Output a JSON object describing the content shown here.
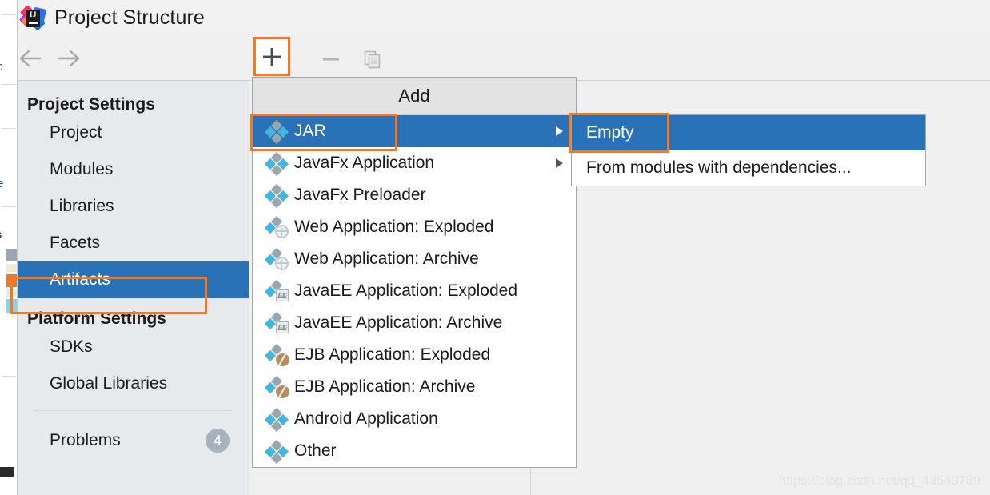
{
  "window": {
    "title": "Project Structure",
    "logo_icon": "intellij-idea-logo"
  },
  "toolbar": {
    "back_icon": "arrow-left-icon",
    "forward_icon": "arrow-right-icon",
    "add_icon": "plus-icon",
    "remove_icon": "minus-icon",
    "copy_icon": "copy-icon"
  },
  "sidebar": {
    "project_settings_label": "Project Settings",
    "project_items": [
      {
        "label": "Project"
      },
      {
        "label": "Modules"
      },
      {
        "label": "Libraries"
      },
      {
        "label": "Facets"
      },
      {
        "label": "Artifacts",
        "selected": true
      }
    ],
    "platform_settings_label": "Platform Settings",
    "platform_items": [
      {
        "label": "SDKs"
      },
      {
        "label": "Global Libraries"
      }
    ],
    "problems_label": "Problems",
    "problems_count": "4"
  },
  "add_menu": {
    "header": "Add",
    "items": [
      {
        "label": "JAR",
        "icon": "artifact-jar-icon",
        "has_submenu": true,
        "highlighted": true
      },
      {
        "label": "JavaFx Application",
        "icon": "artifact-javafx-icon",
        "has_submenu": true,
        "highlighted": false
      },
      {
        "label": "JavaFx Preloader",
        "icon": "artifact-javafx-icon",
        "has_submenu": false,
        "highlighted": false
      },
      {
        "label": "Web Application: Exploded",
        "icon": "artifact-web-icon",
        "has_submenu": false,
        "highlighted": false
      },
      {
        "label": "Web Application: Archive",
        "icon": "artifact-web-icon",
        "has_submenu": false,
        "highlighted": false
      },
      {
        "label": "JavaEE Application: Exploded",
        "icon": "artifact-javaee-icon",
        "has_submenu": false,
        "highlighted": false
      },
      {
        "label": "JavaEE Application: Archive",
        "icon": "artifact-javaee-icon",
        "has_submenu": false,
        "highlighted": false
      },
      {
        "label": "EJB Application: Exploded",
        "icon": "artifact-ejb-icon",
        "has_submenu": false,
        "highlighted": false
      },
      {
        "label": "EJB Application: Archive",
        "icon": "artifact-ejb-icon",
        "has_submenu": false,
        "highlighted": false
      },
      {
        "label": "Android Application",
        "icon": "artifact-android-icon",
        "has_submenu": false,
        "highlighted": false
      },
      {
        "label": "Other",
        "icon": "artifact-other-icon",
        "has_submenu": false,
        "highlighted": false
      }
    ]
  },
  "jar_submenu": {
    "items": [
      {
        "label": "Empty",
        "highlighted": true
      },
      {
        "label": "From modules with dependencies...",
        "highlighted": false
      }
    ]
  },
  "annotations": {
    "highlight_color": "#f47920",
    "boxes": [
      "plus-toolbar-button",
      "artifacts-sidebar-item",
      "jar-menu-item",
      "empty-submenu-item"
    ]
  },
  "watermark": {
    "text": "https://blog.csdn.net/qq_43543789"
  },
  "colors": {
    "selection_blue": "#2a72b8",
    "sidebar_bg": "#e6eaed",
    "panel_bg": "#f0f0f0",
    "menu_bg": "#ffffff",
    "menu_header_bg": "#e3e3e3"
  }
}
